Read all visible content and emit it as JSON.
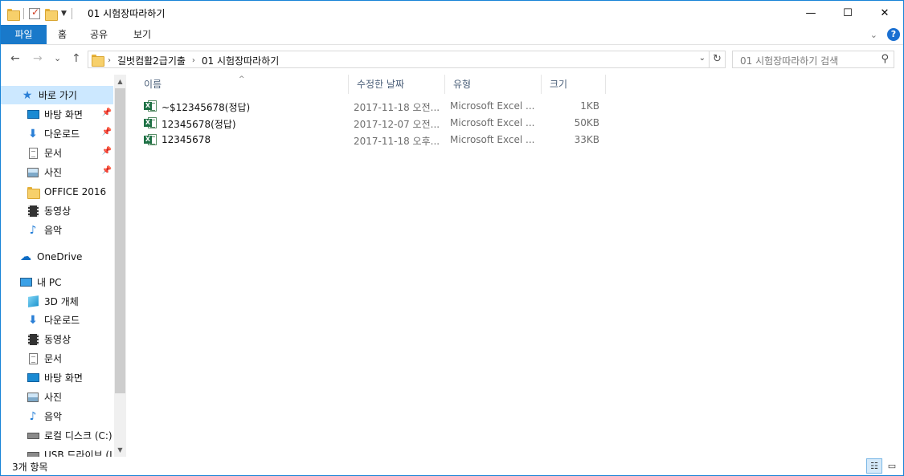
{
  "window": {
    "title": "01 시험장따라하기",
    "caption": {
      "minimize": "—",
      "maximize": "☐",
      "close": "✕"
    }
  },
  "ribbon": {
    "tabs": [
      "파일",
      "홈",
      "공유",
      "보기"
    ],
    "help": "?"
  },
  "nav": {
    "back": "←",
    "forward": "→",
    "recent": "⌄",
    "up": "↑",
    "refresh": "↻",
    "breadcrumb": [
      "길벗컴활2급기출",
      "01 시험장따라하기"
    ],
    "search_placeholder": "01 시험장따라하기 검색"
  },
  "sidebar": {
    "quick_access": "바로 가기",
    "items": [
      {
        "label": "바탕 화면",
        "icon": "desktop-icon",
        "pinned": true
      },
      {
        "label": "다운로드",
        "icon": "download-icon",
        "pinned": true
      },
      {
        "label": "문서",
        "icon": "document-icon",
        "pinned": true
      },
      {
        "label": "사진",
        "icon": "picture-icon",
        "pinned": true
      },
      {
        "label": "OFFICE 2016",
        "icon": "folder-icon",
        "pinned": false
      },
      {
        "label": "동영상",
        "icon": "video-icon",
        "pinned": false
      },
      {
        "label": "음악",
        "icon": "music-icon",
        "pinned": false
      }
    ],
    "onedrive": "OneDrive",
    "this_pc": "내 PC",
    "pc_items": [
      {
        "label": "3D 개체",
        "icon": "3d-objects-icon"
      },
      {
        "label": "다운로드",
        "icon": "download-icon"
      },
      {
        "label": "동영상",
        "icon": "video-icon"
      },
      {
        "label": "문서",
        "icon": "document-icon"
      },
      {
        "label": "바탕 화면",
        "icon": "desktop-icon"
      },
      {
        "label": "사진",
        "icon": "picture-icon"
      },
      {
        "label": "음악",
        "icon": "music-icon"
      },
      {
        "label": "로컬 디스크 (C:)",
        "icon": "drive-icon"
      },
      {
        "label": "USB 드라이브 (I",
        "icon": "usb-drive-icon"
      }
    ]
  },
  "columns": {
    "name": "이름",
    "modified": "수정한 날짜",
    "type": "유형",
    "size": "크기"
  },
  "files": [
    {
      "name": "~$12345678(정답)",
      "modified": "2017-11-18 오전...",
      "type": "Microsoft Excel ...",
      "size": "1KB"
    },
    {
      "name": "12345678(정답)",
      "modified": "2017-12-07 오전...",
      "type": "Microsoft Excel ...",
      "size": "50KB"
    },
    {
      "name": "12345678",
      "modified": "2017-11-18 오후...",
      "type": "Microsoft Excel ...",
      "size": "33KB"
    }
  ],
  "status": {
    "count": "3개 항목"
  },
  "colors": {
    "accent": "#1979ca",
    "selection": "#cce8ff"
  }
}
